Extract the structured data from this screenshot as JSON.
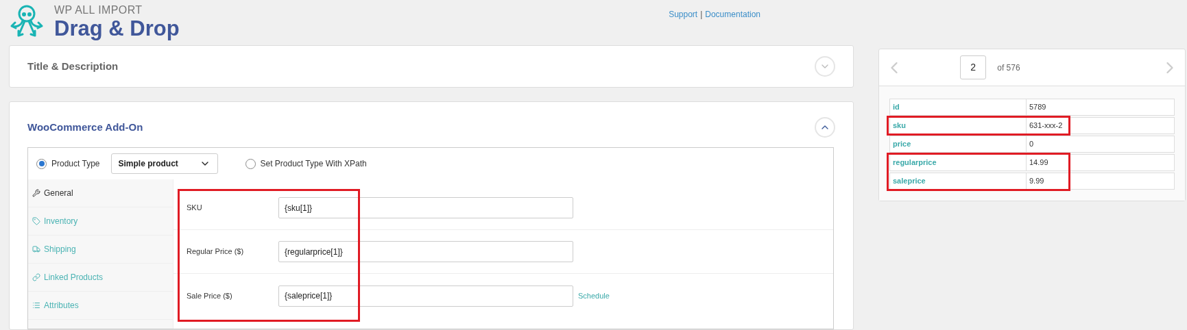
{
  "header": {
    "brand_small": "WP ALL IMPORT",
    "brand_large": "Drag & Drop",
    "links": [
      "Support",
      "Documentation"
    ],
    "separator": "|"
  },
  "sections": [
    {
      "title": "Title & Description",
      "expanded": false
    },
    {
      "title": "WooCommerce Add-On",
      "expanded": true
    }
  ],
  "product_type": {
    "options": [
      {
        "label": "Product Type",
        "selected": true
      },
      {
        "label": "Set Product Type With XPath",
        "selected": false
      }
    ],
    "select_value": "Simple product"
  },
  "tabs": [
    {
      "label": "General",
      "selected": true
    },
    {
      "label": "Inventory",
      "selected": false
    },
    {
      "label": "Shipping",
      "selected": false
    },
    {
      "label": "Linked Products",
      "selected": false
    },
    {
      "label": "Attributes",
      "selected": false
    }
  ],
  "fields": [
    {
      "label": "SKU",
      "value": "{sku[1]}"
    },
    {
      "label": "Regular Price ($)",
      "value": "{regularprice[1]}"
    },
    {
      "label": "Sale Price ($)",
      "value": "{saleprice[1]}",
      "link": "Schedule"
    }
  ],
  "fields_highlighted": true,
  "preview": {
    "page": "2",
    "of": "of 576",
    "rows": [
      {
        "key": "id",
        "value": "5789",
        "highlighted": false
      },
      {
        "key": "sku",
        "value": "631-xxx-2",
        "highlighted": true
      },
      {
        "key": "price",
        "value": "0",
        "highlighted": false
      },
      {
        "key": "regularprice",
        "value": "14.99",
        "highlighted": true
      },
      {
        "key": "saleprice",
        "value": "9.99",
        "highlighted": true
      }
    ]
  }
}
